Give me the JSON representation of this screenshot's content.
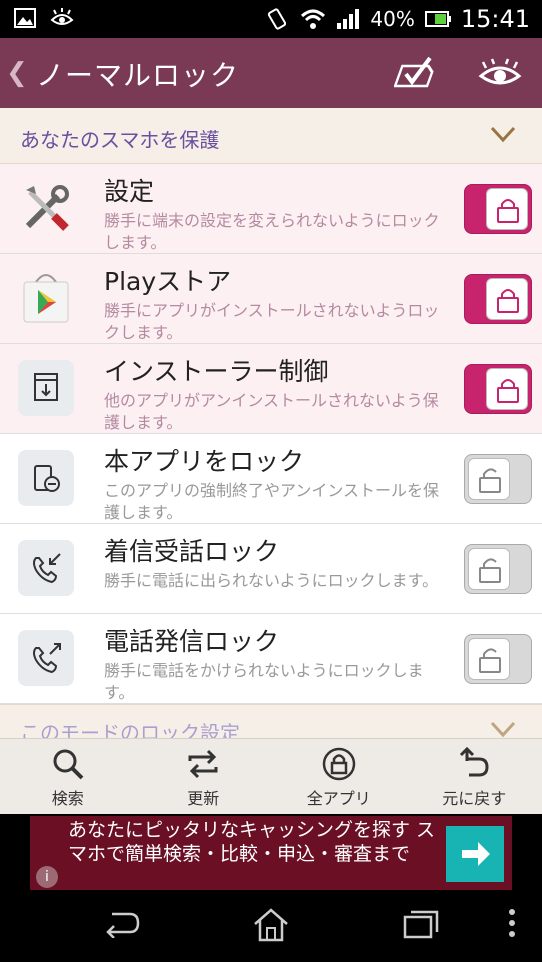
{
  "status": {
    "battery": "40%",
    "time": "15:41"
  },
  "header": {
    "title": "ノーマルロック"
  },
  "section1": {
    "label": "あなたのスマホを保護"
  },
  "items": [
    {
      "name": "設定",
      "desc": "勝手に端末の設定を変えられないようにロックします。",
      "locked": true
    },
    {
      "name": "Playストア",
      "desc": "勝手にアプリがインストールされないようロックします。",
      "locked": true
    },
    {
      "name": "インストーラー制御",
      "desc": "他のアプリがアンインストールされないよう保護します。",
      "locked": true
    },
    {
      "name": "本アプリをロック",
      "desc": "このアプリの強制終了やアンインストールを保護します。",
      "locked": false
    },
    {
      "name": "着信受話ロック",
      "desc": "勝手に電話に出られないようにロックします。",
      "locked": false
    },
    {
      "name": "電話発信ロック",
      "desc": "勝手に電話をかけられないようにロックします。",
      "locked": false
    }
  ],
  "section2": {
    "label": "このモードのロック設定"
  },
  "toolbar": [
    {
      "label": "検索"
    },
    {
      "label": "更新"
    },
    {
      "label": "全アプリ"
    },
    {
      "label": "元に戻す"
    }
  ],
  "ad": {
    "text": "あなたにピッタリなキャッシングを探す スマホで簡単検索・比較・申込・審査まで",
    "info": "i"
  },
  "colors": {
    "header": "#7a3a55",
    "accent": "#c8246d",
    "ad_button": "#18b3b3"
  }
}
